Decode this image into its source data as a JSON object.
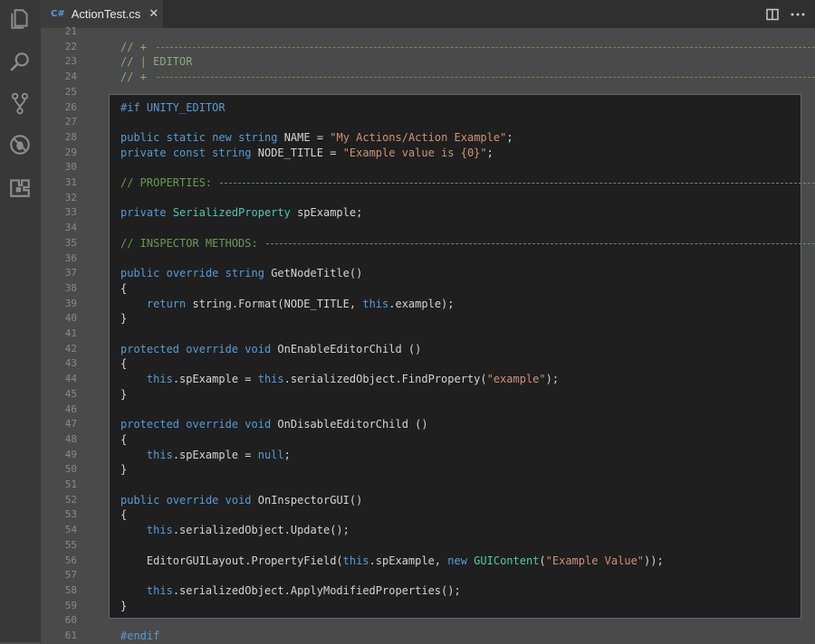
{
  "tab": {
    "lang": "C#",
    "filename": "ActionTest.cs",
    "close": "✕"
  },
  "activity": [
    "files-icon",
    "search-icon",
    "source-control-icon",
    "debug-icon",
    "extensions-icon"
  ],
  "header_lines": [
    {
      "n": "21",
      "text": ""
    },
    {
      "n": "22",
      "text": "// +"
    },
    {
      "n": "23",
      "text": "// | EDITOR"
    },
    {
      "n": "24",
      "text": "// +"
    },
    {
      "n": "25",
      "text": ""
    }
  ],
  "lines": [
    {
      "n": "26",
      "parts": [
        [
          "pp",
          "#if UNITY_EDITOR"
        ]
      ]
    },
    {
      "n": "27",
      "parts": []
    },
    {
      "n": "28",
      "parts": [
        [
          "kw",
          "public"
        ],
        [
          "",
          " "
        ],
        [
          "kw",
          "static"
        ],
        [
          "",
          " "
        ],
        [
          "kw",
          "new"
        ],
        [
          "",
          " "
        ],
        [
          "kw",
          "string"
        ],
        [
          "",
          " NAME = "
        ],
        [
          "str",
          "\"My Actions/Action Example\""
        ],
        [
          "",
          ";"
        ]
      ]
    },
    {
      "n": "29",
      "parts": [
        [
          "kw",
          "private"
        ],
        [
          "",
          " "
        ],
        [
          "kw",
          "const"
        ],
        [
          "",
          " "
        ],
        [
          "kw",
          "string"
        ],
        [
          "",
          " NODE_TITLE = "
        ],
        [
          "str",
          "\"Example value is {0}\""
        ],
        [
          "",
          ";"
        ]
      ]
    },
    {
      "n": "30",
      "parts": []
    },
    {
      "n": "31",
      "parts": [
        [
          "cm",
          "// PROPERTIES: "
        ]
      ],
      "dash": true
    },
    {
      "n": "32",
      "parts": []
    },
    {
      "n": "33",
      "parts": [
        [
          "kw",
          "private"
        ],
        [
          "",
          " "
        ],
        [
          "ty",
          "SerializedProperty"
        ],
        [
          "",
          " spExample;"
        ]
      ]
    },
    {
      "n": "34",
      "parts": []
    },
    {
      "n": "35",
      "parts": [
        [
          "cm",
          "// INSPECTOR METHODS: "
        ]
      ],
      "dash": true
    },
    {
      "n": "36",
      "parts": []
    },
    {
      "n": "37",
      "parts": [
        [
          "kw",
          "public"
        ],
        [
          "",
          " "
        ],
        [
          "kw",
          "override"
        ],
        [
          "",
          " "
        ],
        [
          "kw",
          "string"
        ],
        [
          "",
          " GetNodeTitle()"
        ]
      ]
    },
    {
      "n": "38",
      "parts": [
        [
          "",
          "{"
        ]
      ]
    },
    {
      "n": "39",
      "parts": [
        [
          "",
          "    "
        ],
        [
          "kw",
          "return"
        ],
        [
          "",
          " string.Format(NODE_TITLE, "
        ],
        [
          "kw",
          "this"
        ],
        [
          "",
          ".example);"
        ]
      ]
    },
    {
      "n": "40",
      "parts": [
        [
          "",
          "}"
        ]
      ]
    },
    {
      "n": "41",
      "parts": []
    },
    {
      "n": "42",
      "parts": [
        [
          "kw",
          "protected"
        ],
        [
          "",
          " "
        ],
        [
          "kw",
          "override"
        ],
        [
          "",
          " "
        ],
        [
          "kw",
          "void"
        ],
        [
          "",
          " OnEnableEditorChild ()"
        ]
      ]
    },
    {
      "n": "43",
      "parts": [
        [
          "",
          "{"
        ]
      ]
    },
    {
      "n": "44",
      "parts": [
        [
          "",
          "    "
        ],
        [
          "kw",
          "this"
        ],
        [
          "",
          ".spExample = "
        ],
        [
          "kw",
          "this"
        ],
        [
          "",
          ".serializedObject.FindProperty("
        ],
        [
          "str",
          "\"example\""
        ],
        [
          "",
          ");"
        ]
      ]
    },
    {
      "n": "45",
      "parts": [
        [
          "",
          "}"
        ]
      ]
    },
    {
      "n": "46",
      "parts": []
    },
    {
      "n": "47",
      "parts": [
        [
          "kw",
          "protected"
        ],
        [
          "",
          " "
        ],
        [
          "kw",
          "override"
        ],
        [
          "",
          " "
        ],
        [
          "kw",
          "void"
        ],
        [
          "",
          " OnDisableEditorChild ()"
        ]
      ]
    },
    {
      "n": "48",
      "parts": [
        [
          "",
          "{"
        ]
      ]
    },
    {
      "n": "49",
      "parts": [
        [
          "",
          "    "
        ],
        [
          "kw",
          "this"
        ],
        [
          "",
          ".spExample = "
        ],
        [
          "kw",
          "null"
        ],
        [
          "",
          ";"
        ]
      ]
    },
    {
      "n": "50",
      "parts": [
        [
          "",
          "}"
        ]
      ]
    },
    {
      "n": "51",
      "parts": []
    },
    {
      "n": "52",
      "parts": [
        [
          "kw",
          "public"
        ],
        [
          "",
          " "
        ],
        [
          "kw",
          "override"
        ],
        [
          "",
          " "
        ],
        [
          "kw",
          "void"
        ],
        [
          "",
          " OnInspectorGUI()"
        ]
      ]
    },
    {
      "n": "53",
      "parts": [
        [
          "",
          "{"
        ]
      ]
    },
    {
      "n": "54",
      "parts": [
        [
          "",
          "    "
        ],
        [
          "kw",
          "this"
        ],
        [
          "",
          ".serializedObject.Update();"
        ]
      ]
    },
    {
      "n": "55",
      "parts": []
    },
    {
      "n": "56",
      "parts": [
        [
          "",
          "    EditorGUILayout.PropertyField("
        ],
        [
          "kw",
          "this"
        ],
        [
          "",
          ".spExample, "
        ],
        [
          "kw",
          "new"
        ],
        [
          "",
          " "
        ],
        [
          "ty",
          "GUIContent"
        ],
        [
          "",
          "("
        ],
        [
          "str",
          "\"Example Value\""
        ],
        [
          "",
          "));"
        ]
      ]
    },
    {
      "n": "57",
      "parts": []
    },
    {
      "n": "58",
      "parts": [
        [
          "",
          "    "
        ],
        [
          "kw",
          "this"
        ],
        [
          "",
          ".serializedObject.ApplyModifiedProperties();"
        ]
      ]
    },
    {
      "n": "59",
      "parts": [
        [
          "",
          "}"
        ]
      ]
    },
    {
      "n": "60",
      "parts": []
    },
    {
      "n": "61",
      "parts": [
        [
          "pp",
          "#endif"
        ]
      ]
    }
  ]
}
